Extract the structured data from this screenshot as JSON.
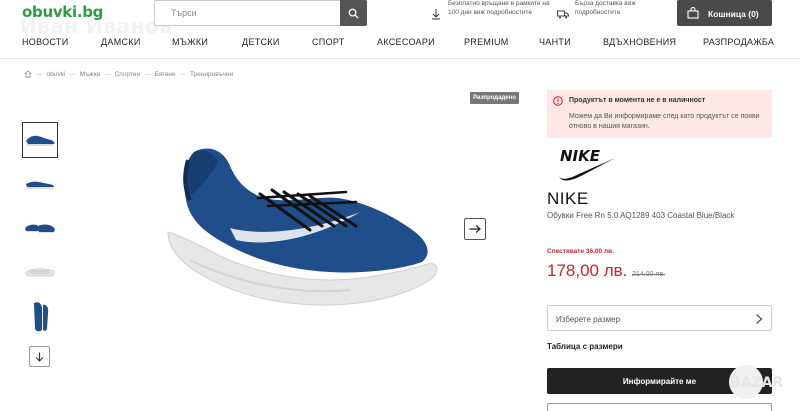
{
  "header": {
    "logo": "obuvki.bg",
    "watermark_name": "Иван Иванов",
    "search": {
      "placeholder": "Търси"
    },
    "return_info": "Безплатно връщане в рамките на 100 дни виж подробностите",
    "delivery_info": "Бърза доставка виж подробностите",
    "cart_label": "Кошница (0)"
  },
  "nav": {
    "items": [
      "НОВОСТИ",
      "ДАМСКИ",
      "МЪЖКИ",
      "ДЕТСКИ",
      "СПОРТ",
      "АКСЕСОАРИ",
      "PREMIUM",
      "ЧАНТИ",
      "ВДЪХНОВЕНИЯ",
      "РАЗПРОДАЖБА"
    ]
  },
  "breadcrumb": [
    "obuvki",
    "Мъжки",
    "Спортни",
    "Бягане",
    "Тренировъчни"
  ],
  "gallery": {
    "badge": "Разпродадено",
    "thumbnails": [
      "shoe-side",
      "shoe-side-2",
      "shoe-pair",
      "shoe-sole",
      "shoe-top"
    ]
  },
  "product": {
    "alert_title": "Продуктът в момента не е в наличност",
    "alert_text": "Можем да Ви информираме след като продуктът се появи отново в нашия магазин.",
    "brand": "NIKE",
    "name": "Обувки Free Rn 5.0 AQ1289 403 Coastal Blue/Black",
    "savings": "Спестявате 36,00 лв.",
    "price": "178,00 лв.",
    "old_price": "214,00 лв.",
    "size_placeholder": "Изберете размер",
    "size_table": "Таблица с размери",
    "notify_button": "Информирайте ме"
  },
  "colors": {
    "logo_green": "#2f9c3f",
    "sale_red": "#d0232a",
    "alert_bg": "#fde7e7",
    "shoe_blue": "#1f4e8a"
  }
}
